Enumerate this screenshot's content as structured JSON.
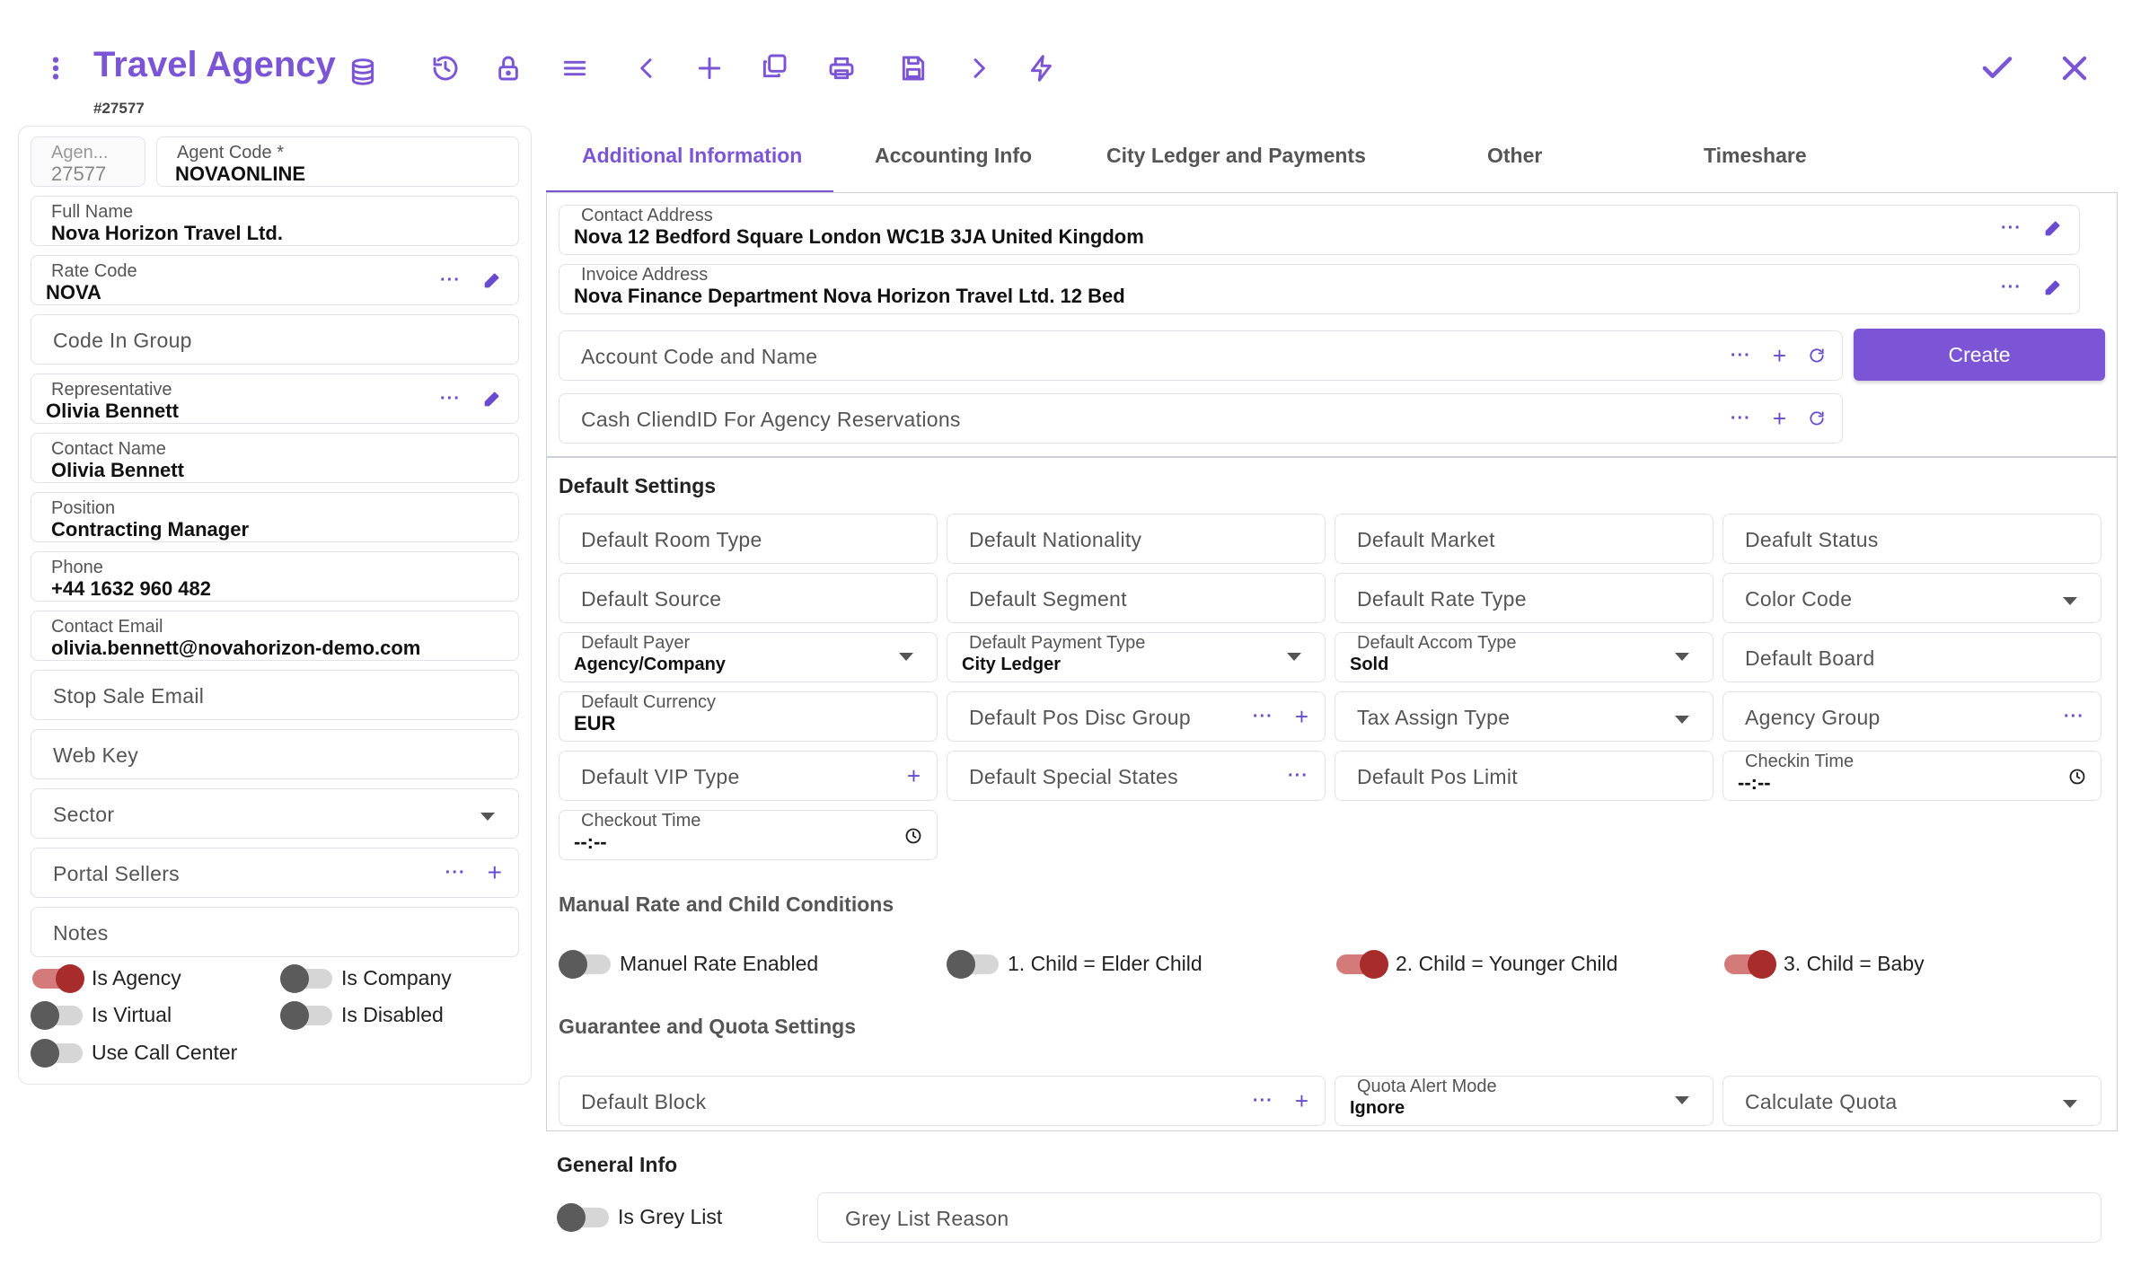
{
  "header": {
    "title": "Travel Agency",
    "record_id": "#27577",
    "icons": [
      "more-vert-icon",
      "database-icon",
      "history-icon",
      "lock-icon",
      "menu-icon",
      "chevron-left-icon",
      "plus-icon",
      "copy-icon",
      "print-icon",
      "save-icon",
      "chevron-right-icon",
      "lightning-icon",
      "check-icon",
      "close-icon"
    ],
    "accent_color": "#7b55d6"
  },
  "left": {
    "agency_id_label": "Agen...",
    "agency_id_value": "27577",
    "agent_code_label": "Agent Code *",
    "agent_code_value": "NOVAONLINE",
    "full_name_label": "Full Name",
    "full_name_value": "Nova Horizon Travel Ltd.",
    "rate_code_label": "Rate Code",
    "rate_code_value": "NOVA",
    "code_in_group": "Code In Group",
    "representative_label": "Representative",
    "representative_value": "Olivia Bennett",
    "contact_name_label": "Contact Name",
    "contact_name_value": "Olivia Bennett",
    "position_label": "Position",
    "position_value": "Contracting Manager",
    "phone_label": "Phone",
    "phone_value": "+44 1632 960 482",
    "email_label": "Contact Email",
    "email_value": "olivia.bennett@novahorizon-demo.com",
    "stop_sale_email": "Stop Sale Email",
    "web_key": "Web Key",
    "sector": "Sector",
    "portal_sellers": "Portal Sellers",
    "notes": "Notes",
    "toggles": [
      {
        "label": "Is Agency",
        "on": true
      },
      {
        "label": "Is Company",
        "on": false
      },
      {
        "label": "Is Virtual",
        "on": false
      },
      {
        "label": "Is Disabled",
        "on": false
      },
      {
        "label": "Use Call Center",
        "on": false
      }
    ]
  },
  "tabs": [
    "Additional Information",
    "Accounting Info",
    "City Ledger and Payments",
    "Other",
    "Timeshare"
  ],
  "additional": {
    "contact_address_label": "Contact Address",
    "contact_address_value": "Nova 12 Bedford Square London WC1B 3JA United Kingdom",
    "invoice_address_label": "Invoice Address",
    "invoice_address_value": "Nova Finance Department Nova Horizon Travel Ltd. 12 Bed",
    "account_code": "Account Code and Name",
    "create_button": "Create",
    "cash_client": "Cash CliendID For Agency Reservations"
  },
  "default_settings": {
    "title": "Default Settings",
    "room_type": "Default Room Type",
    "nationality": "Default Nationality",
    "market": "Default Market",
    "status": "Deafult Status",
    "source": "Default Source",
    "segment": "Default Segment",
    "rate_type": "Default Rate Type",
    "color_code": "Color Code",
    "payer_label": "Default Payer",
    "payer_value": "Agency/Company",
    "payment_type_label": "Default Payment Type",
    "payment_type_value": "City Ledger",
    "accom_type_label": "Default Accom Type",
    "accom_type_value": "Sold",
    "board": "Default Board",
    "currency_label": "Default Currency",
    "currency_value": "EUR",
    "pos_disc_group": "Default Pos Disc Group",
    "tax_assign_type": "Tax Assign Type",
    "agency_group": "Agency Group",
    "vip_type": "Default VIP Type",
    "special_states": "Default Special States",
    "pos_limit": "Default Pos Limit",
    "checkin_label": "Checkin Time",
    "checkin_value": "--:--",
    "checkout_label": "Checkout Time",
    "checkout_value": "--:--"
  },
  "manual_rate": {
    "title": "Manual Rate and Child Conditions",
    "toggles": [
      {
        "label": "Manuel Rate Enabled",
        "on": false
      },
      {
        "label": "1. Child = Elder Child",
        "on": false
      },
      {
        "label": "2. Child = Younger Child",
        "on": true
      },
      {
        "label": "3. Child = Baby",
        "on": true
      }
    ]
  },
  "guarantee": {
    "title": "Guarantee and Quota Settings",
    "default_block": "Default Block",
    "quota_alert_label": "Quota Alert Mode",
    "quota_alert_value": "Ignore",
    "calculate_quota": "Calculate Quota"
  },
  "general": {
    "title": "General Info",
    "grey_list_toggle": "Is Grey List",
    "grey_list_reason": "Grey List Reason"
  }
}
